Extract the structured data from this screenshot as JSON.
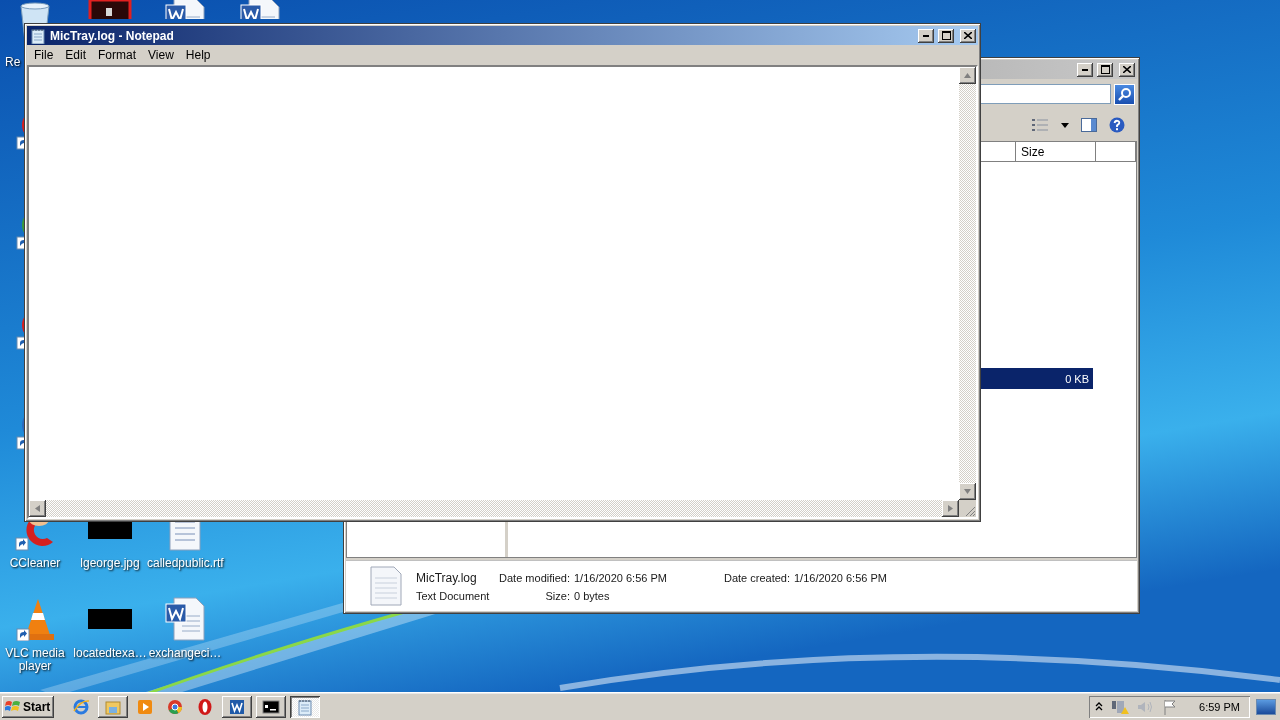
{
  "desktop_icons": [
    {
      "kind": "recycle-bin",
      "label": "Re"
    },
    {
      "kind": "red-app"
    },
    {
      "kind": "word-doc"
    },
    {
      "kind": "word-doc"
    },
    {
      "kind": "red-shortcut"
    },
    {
      "kind": "green-shortcut"
    },
    {
      "kind": "red-shortcut"
    },
    {
      "kind": "blue-shortcut"
    },
    {
      "kind": "ccleaner",
      "label": "CCleaner"
    },
    {
      "kind": "black-image",
      "label": "lgeorge.jpg"
    },
    {
      "kind": "text-doc",
      "label": "calledpublic.rtf"
    },
    {
      "kind": "vlc",
      "label": "VLC media player"
    },
    {
      "kind": "black-image",
      "label": "locatedtexa…"
    },
    {
      "kind": "word-doc",
      "label": "exchangeci…"
    }
  ],
  "explorer": {
    "columns": [
      {
        "label": "Size"
      }
    ],
    "rows": [
      {
        "size": "0 KB",
        "selected": true
      }
    ],
    "details": {
      "name": "MicTray.log",
      "type": "Text Document",
      "fields": [
        {
          "label": "Date modified:",
          "value": "1/16/2020 6:56 PM"
        },
        {
          "label": "Date created:",
          "value": "1/16/2020 6:56 PM"
        },
        {
          "label": "Size:",
          "value": "0 bytes"
        }
      ]
    }
  },
  "notepad": {
    "title": "MicTray.log - Notepad",
    "menu": [
      "File",
      "Edit",
      "Format",
      "View",
      "Help"
    ]
  },
  "taskbar": {
    "start": "Start",
    "items": [
      {
        "kind": "ie"
      },
      {
        "kind": "explorer",
        "selected": false
      },
      {
        "kind": "media"
      },
      {
        "kind": "chrome"
      },
      {
        "kind": "opera"
      },
      {
        "kind": "word",
        "selected": false
      },
      {
        "kind": "cmd",
        "selected": false
      },
      {
        "kind": "notepad",
        "selected": true
      }
    ],
    "clock": "6:59 PM"
  }
}
